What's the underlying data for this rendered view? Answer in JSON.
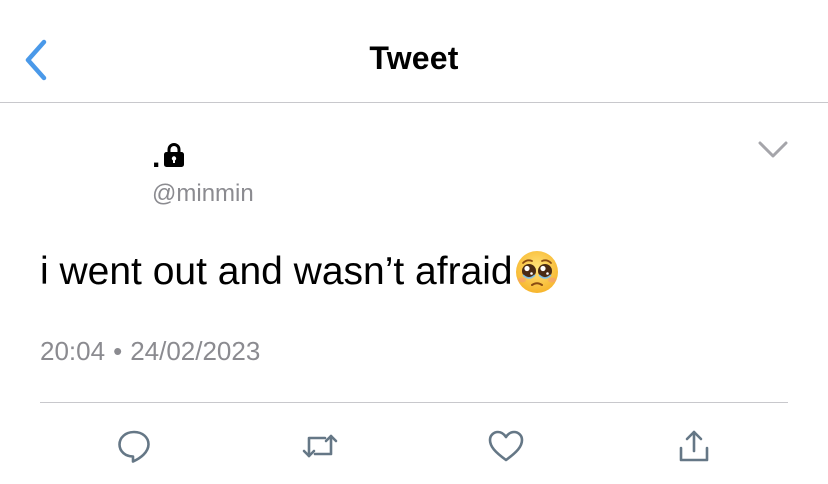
{
  "header": {
    "title": "Tweet",
    "back_icon": "chevron-left-icon"
  },
  "author": {
    "display_name": ".",
    "protected_icon": "lock-icon",
    "handle": "@minmin"
  },
  "tweet": {
    "text": "i went out and wasn’t afraid",
    "emoji": "pleading-face-emoji",
    "time": "20:04",
    "separator": "•",
    "date": "24/02/2023"
  },
  "actions": {
    "reply_icon": "reply-icon",
    "retweet_icon": "retweet-icon",
    "like_icon": "heart-icon",
    "share_icon": "share-icon"
  },
  "colors": {
    "accent": "#4a99e9",
    "secondary_text": "#8b8b90",
    "divider": "#c8c8cc",
    "icon": "#657786"
  }
}
